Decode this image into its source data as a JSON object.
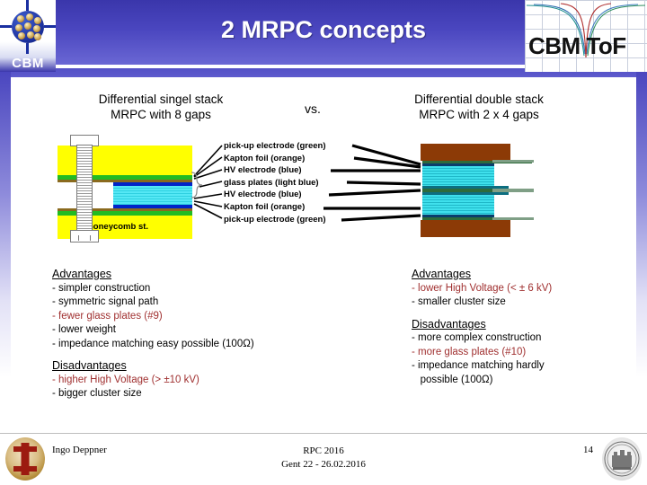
{
  "header": {
    "title": "2 MRPC concepts",
    "left_logo_text": "CBM",
    "right_logo_text": "CBM ToF",
    "band_color": "#4a46bf"
  },
  "subtitles": {
    "left_line1": "Differential singel stack",
    "left_line2": "MRPC with 8 gaps",
    "vs": "vs.",
    "right_line1": "Differential double stack",
    "right_line2": "MRPC with 2 x 4 gaps"
  },
  "diagram": {
    "honeycomb_label": "honeycomb st.",
    "layer_labels": [
      "pick-up electrode (green)",
      "Kapton foil (orange)",
      "HV electrode (blue)",
      "glass plates (light blue)",
      "HV electrode (blue)",
      "Kapton foil (orange)",
      "pick-up electrode (green)"
    ],
    "colors": {
      "honeycomb": "#ffff00",
      "pickup_electrode": "#22bb22",
      "kapton_foil": "#8a6a1e",
      "hv_electrode": "#0024c8",
      "glass_plates": "#55e8f5",
      "double_stack_honeycomb": "#8c3a06",
      "double_stack_glass": "#2fd6e4",
      "double_stack_electrode": "#2e6b3a"
    }
  },
  "left_column": {
    "advantages_heading": "Advantages",
    "advantages": [
      {
        "text": "- simpler construction",
        "highlight": false
      },
      {
        "text": "- symmetric signal path",
        "highlight": false
      },
      {
        "text": "- fewer glass plates (#9)",
        "highlight": true
      },
      {
        "text": "- lower weight",
        "highlight": false
      },
      {
        "text": "- impedance matching easy possible (100Ω)",
        "highlight": false
      }
    ],
    "disadvantages_heading": "Disadvantages",
    "disadvantages": [
      {
        "text": "- higher High Voltage (> ±10 kV)",
        "highlight": true
      },
      {
        "text": "- bigger cluster size",
        "highlight": false
      }
    ]
  },
  "right_column": {
    "advantages_heading": "Advantages",
    "advantages": [
      {
        "text": "- lower High Voltage (< ± 6 kV)",
        "highlight": true
      },
      {
        "text": "- smaller cluster size",
        "highlight": false
      }
    ],
    "disadvantages_heading": "Disadvantages",
    "disadvantages": [
      {
        "text": "- more complex construction",
        "highlight": false
      },
      {
        "text": "- more glass plates (#10)",
        "highlight": true
      },
      {
        "text": "- impedance matching hardly",
        "highlight": false
      },
      {
        "text": "   possible (100Ω)",
        "highlight": false
      }
    ]
  },
  "footer": {
    "author": "Ingo Deppner",
    "event_line1": "RPC 2016",
    "event_line2": "Gent  22 - 26.02.2016",
    "page_number": "14"
  },
  "highlight_color": "#a03030"
}
